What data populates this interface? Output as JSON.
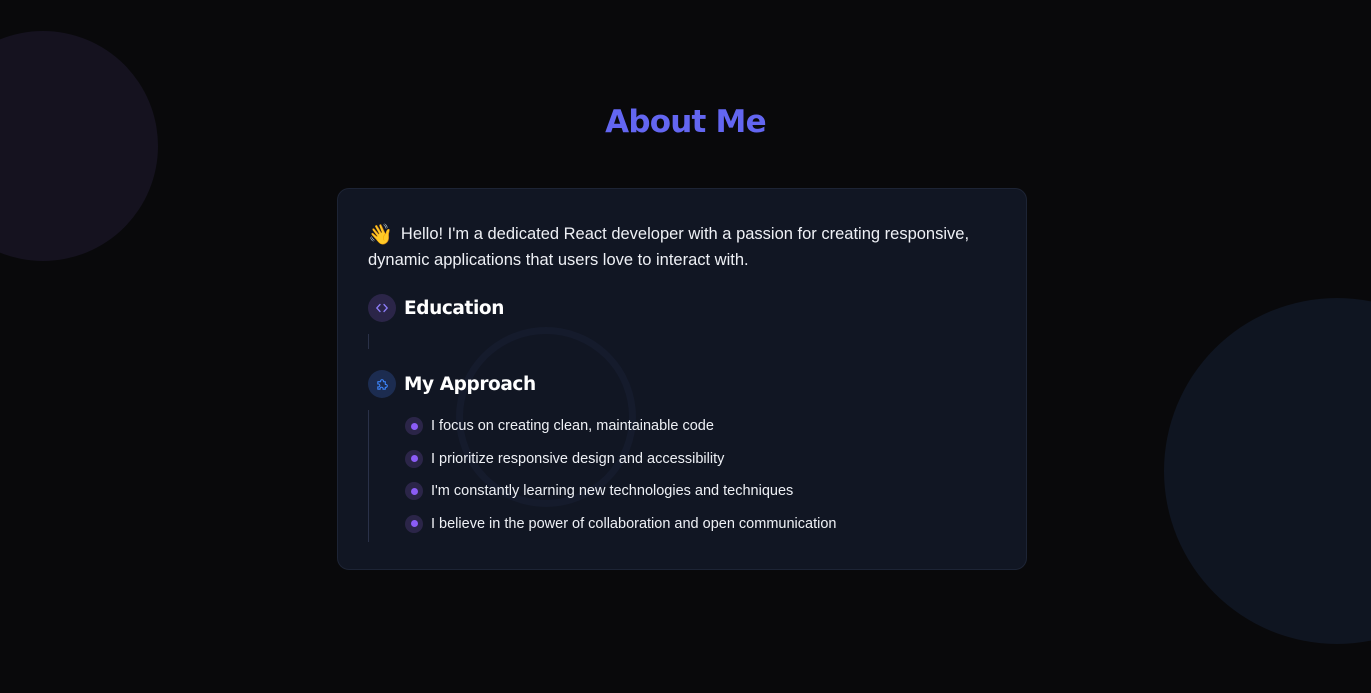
{
  "title": "About Me",
  "intro": {
    "emoji": "👋",
    "text": "Hello! I'm a dedicated React developer with a passion for creating responsive, dynamic applications that users love to interact with."
  },
  "education": {
    "title": "Education",
    "icon": "code-icon"
  },
  "approach": {
    "title": "My Approach",
    "icon": "puzzle-icon",
    "items": [
      "I focus on creating clean, maintainable code",
      "I prioritize responsive design and accessibility",
      "I'm constantly learning new technologies and techniques",
      "I believe in the power of collaboration and open communication"
    ]
  },
  "colors": {
    "accent": "#6366f1",
    "bullet": "#8b5cf6",
    "background": "#09090b",
    "card": "#111623"
  }
}
